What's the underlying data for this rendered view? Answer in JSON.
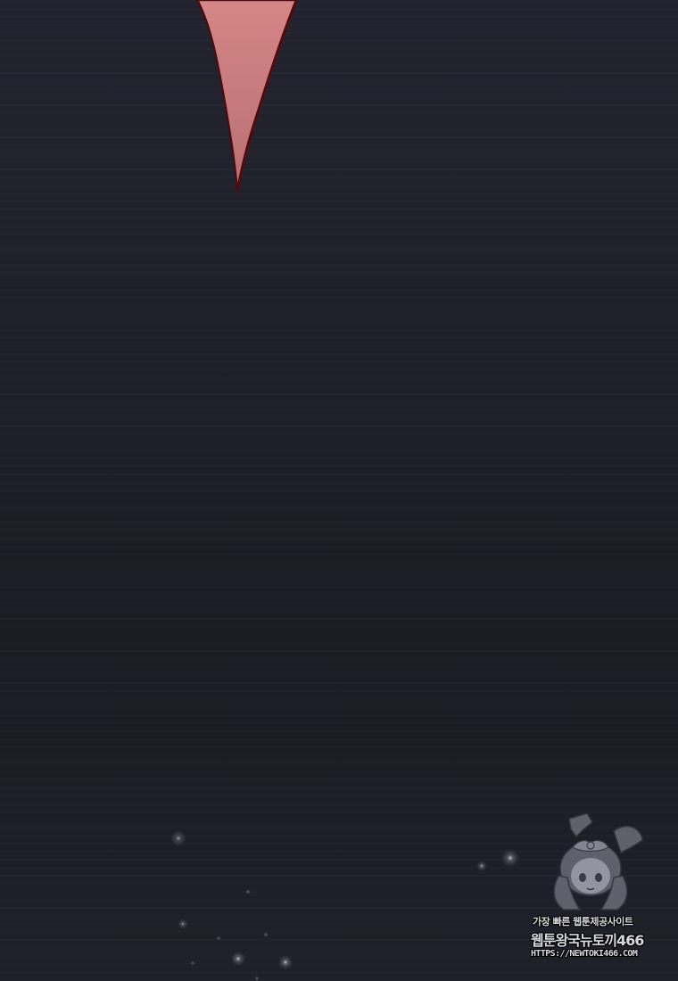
{
  "colors": {
    "background": "#1e1f29",
    "blade_fill": "#c97a7a",
    "blade_outline": "#5a0c10",
    "watermark_text": "#d7d7dd"
  },
  "watermark": {
    "mascot_icon": "bunny-girl-mascot-icon",
    "line1": "가장 빠른 웹툰제공사이트",
    "line2": "웹툰왕국뉴토끼466",
    "line3": "HTTPS://NEWTOKI466.COM"
  }
}
